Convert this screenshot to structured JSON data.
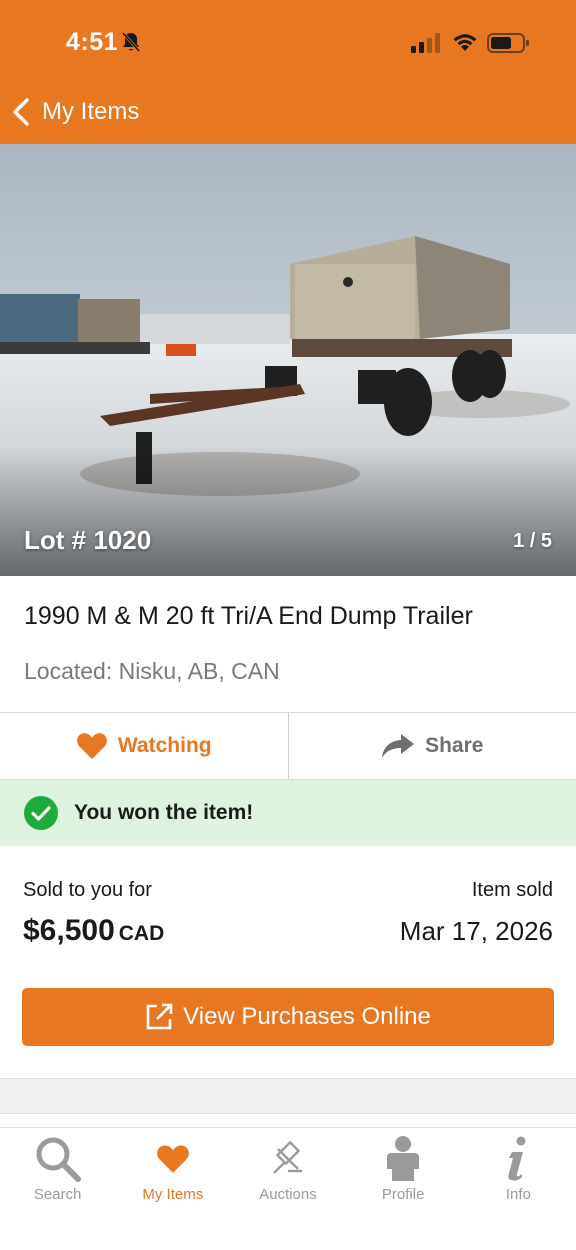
{
  "status_bar": {
    "time": "4:51"
  },
  "nav": {
    "back_label": "My Items"
  },
  "gallery": {
    "lot_label": "Lot # 1020",
    "counter": "1 / 5"
  },
  "item": {
    "title": "1990 M & M 20 ft Tri/A End Dump Trailer",
    "location": "Located: Nisku, AB, CAN"
  },
  "actions": {
    "watch_label": "Watching",
    "share_label": "Share"
  },
  "won_banner": {
    "text": "You won the item!"
  },
  "sale": {
    "sold_label": "Sold to you for",
    "price": "$6,500",
    "currency": "CAD",
    "date_label": "Item sold",
    "date": "Mar 17, 2026"
  },
  "primary_button": {
    "label": "View Purchases Online"
  },
  "tabbar": {
    "tabs": [
      {
        "label": "Search",
        "icon": "search-icon"
      },
      {
        "label": "My Items",
        "icon": "heart-icon"
      },
      {
        "label": "Auctions",
        "icon": "gavel-icon"
      },
      {
        "label": "Profile",
        "icon": "person-icon"
      },
      {
        "label": "Info",
        "icon": "info-icon"
      }
    ]
  },
  "colors": {
    "brand": "#E87722",
    "success": "#1FAA3B",
    "success_bg": "#DDF2DF"
  }
}
